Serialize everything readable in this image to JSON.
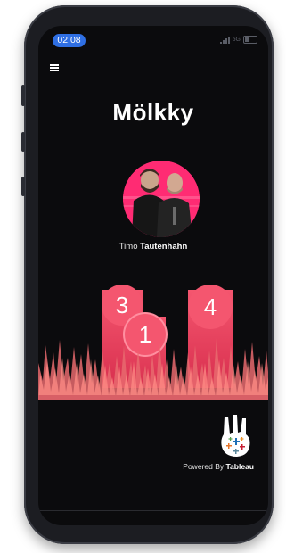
{
  "status": {
    "time": "02:08",
    "carrier": "5G"
  },
  "header": {
    "menu_icon": "hamburger-menu-icon",
    "title": "Mölkky"
  },
  "player": {
    "first_name": "Timo",
    "last_name": "Tautenhahn",
    "avatar_icon": "player-photo"
  },
  "game": {
    "pins": [
      {
        "number": "3",
        "color": "#f4566f"
      },
      {
        "number": "1",
        "color": "#f4566f"
      },
      {
        "number": "4",
        "color": "#f4566f"
      }
    ],
    "grass_color": "#ff7a7a"
  },
  "footer": {
    "powered_prefix": "Powered By",
    "brand": "Tableau",
    "logo_icon": "rock-hand-tableau-logo-icon"
  },
  "colors": {
    "accent": "#ff2b73",
    "pin": "#f4566f",
    "background": "#0b0b0d",
    "status_pill": "#2f6fe3"
  }
}
